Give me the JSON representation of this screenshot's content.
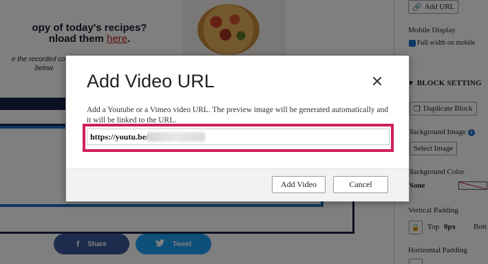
{
  "background_page": {
    "heading_line1": "opy of today's recipes?",
    "heading_line2_prefix": "nload them ",
    "heading_link": "here",
    "heading_line2_suffix": ".",
    "sub_line1": "e the recorded cookin",
    "sub_line2": "below.",
    "share_facebook": "Share",
    "share_twitter": "Tweet"
  },
  "settings_panel": {
    "add_url_label": "Add URL",
    "mobile_display_label": "Mobile Display",
    "full_width_label": "Full width on mobile",
    "full_width_checked": true,
    "section_title": "BLOCK SETTING",
    "duplicate_block_label": "Duplicate Block",
    "background_image_label": "Background Image",
    "select_image_label": "Select Image",
    "background_color_label": "Background Color",
    "background_color_value": "None",
    "vertical_padding_label": "Vertical Padding",
    "top_label": "Top",
    "top_value": "0px",
    "bottom_label_partial": "Bott",
    "horizontal_padding_label": "Horizontal Padding"
  },
  "modal": {
    "title": "Add Video URL",
    "description": "Add a Youtube or a Vimeo video URL. The preview image will be generated automatically and it will be linked to the URL.",
    "url_value": "https://youtu.be/",
    "add_button": "Add Video",
    "cancel_button": "Cancel"
  },
  "colors": {
    "highlight": "#d01f5a",
    "navy": "#17234a",
    "facebook": "#3b5998",
    "twitter": "#1da1f2",
    "checkbox_blue": "#1f6fd0"
  },
  "icons": {
    "close": "close-icon",
    "facebook": "facebook-icon",
    "twitter": "twitter-icon",
    "link": "link-icon",
    "copy": "copy-icon",
    "info": "info-icon",
    "lock": "lock-icon"
  }
}
